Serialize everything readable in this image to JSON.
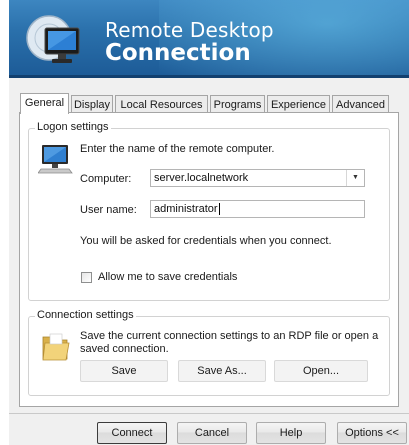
{
  "banner": {
    "title_line1": "Remote Desktop",
    "title_line2": "Connection"
  },
  "tabs": [
    {
      "label": "General",
      "active": true
    },
    {
      "label": "Display",
      "active": false
    },
    {
      "label": "Local Resources",
      "active": false
    },
    {
      "label": "Programs",
      "active": false
    },
    {
      "label": "Experience",
      "active": false
    },
    {
      "label": "Advanced",
      "active": false
    }
  ],
  "logon": {
    "group_label": "Logon settings",
    "instruction": "Enter the name of the remote computer.",
    "computer_label": "Computer:",
    "computer_value": "server.localnetwork",
    "username_label": "User name:",
    "username_value": "administrator",
    "credentials_note": "You will be asked for credentials when you connect.",
    "save_credentials_label": "Allow me to save credentials",
    "save_credentials_checked": false
  },
  "connection": {
    "group_label": "Connection settings",
    "description": "Save the current connection settings to an RDP file or open a saved connection.",
    "save_label": "Save",
    "save_as_label": "Save As...",
    "open_label": "Open..."
  },
  "footer": {
    "connect_label": "Connect",
    "cancel_label": "Cancel",
    "help_label": "Help",
    "options_label": "Options <<"
  },
  "colors": {
    "banner": "#2a70ab",
    "window_bg": "#f0f0f0",
    "panel_bg": "#ffffff"
  },
  "icons": [
    "remote-desktop-monitor-icon",
    "computer-icon",
    "folder-icon",
    "combo-arrow-icon"
  ]
}
